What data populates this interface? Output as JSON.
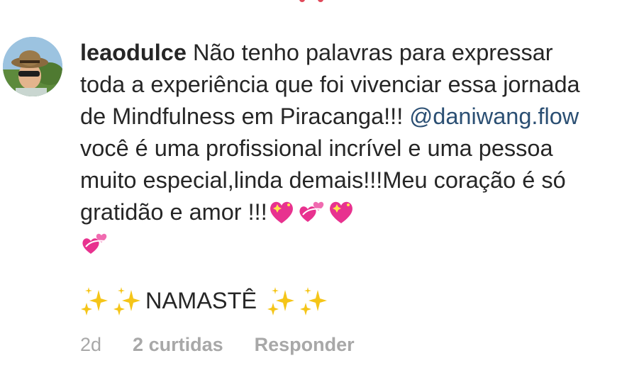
{
  "comment": {
    "username": "leaodulce",
    "text_part1": "Não tenho palavras para expressar toda a experiência que foi vivenciar essa jornada de Mindfulness em Piracanga!!! ",
    "mention": "@daniwang.flow",
    "text_part2": " você é uma profissional incrível e uma pessoa muito especial,linda demais!!!Meu coração é só gratidão e amor !!!",
    "emojis": [
      "sparkling-heart",
      "revolving-hearts",
      "sparkling-heart",
      "revolving-hearts"
    ],
    "namaste_text": "NAMASTÊ",
    "sparkle_icons": [
      "sparkles",
      "sparkles",
      "sparkles",
      "sparkles"
    ]
  },
  "meta": {
    "time": "2d",
    "likes": "2 curtidas",
    "reply": "Responder"
  },
  "colors": {
    "text": "#262626",
    "mention": "#2b4f73",
    "meta": "#a8a8a8",
    "heart": "#e8328f",
    "sparkle": "#f5c518"
  }
}
